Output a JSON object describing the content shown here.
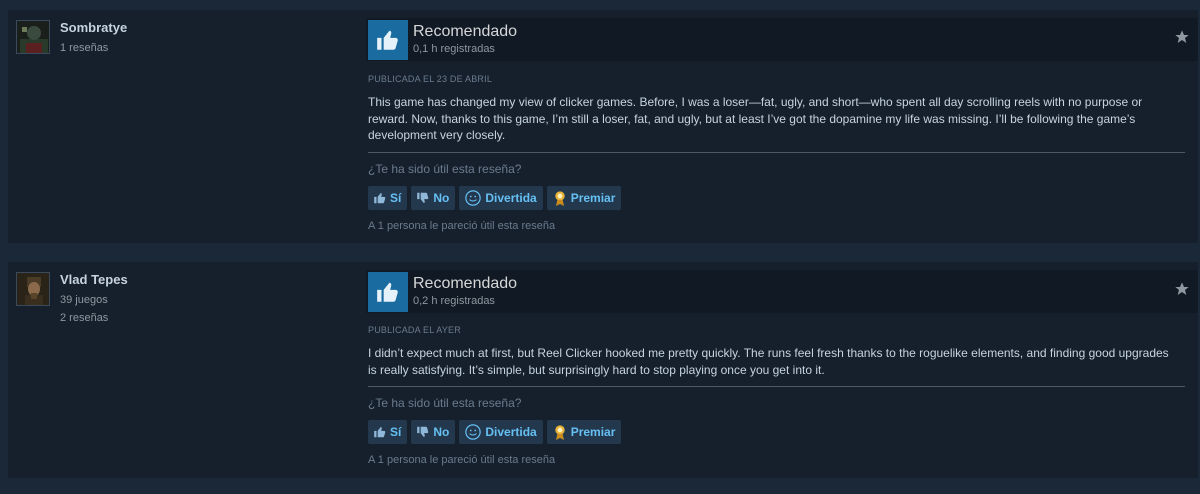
{
  "reviews": [
    {
      "author": "Sombratye",
      "author_lines": [
        "1 reseñas"
      ],
      "verdict": "Recomendado",
      "hours": "0,1 h registradas",
      "posted": "PUBLICADA EL 23 DE ABRIL",
      "text": "This game has changed my view of clicker games. Before, I was a loser—fat, ugly, and short—who spent all day scrolling reels with no purpose or reward. Now, thanks to this game, I’m still a loser, fat, and ugly, but at least I’ve got the dopamine my life was missing. I’ll be following the game’s development very closely.",
      "helpful_question": "¿Te ha sido útil esta reseña?",
      "buttons": {
        "yes": "Sí",
        "no": "No",
        "funny": "Divertida",
        "award": "Premiar"
      },
      "found_helpful": "A 1 persona le pareció útil esta reseña"
    },
    {
      "author": "Vlad Tepes",
      "author_lines": [
        "39 juegos",
        "2 reseñas"
      ],
      "verdict": "Recomendado",
      "hours": "0,2 h registradas",
      "posted": "PUBLICADA EL AYER",
      "text": "I didn’t expect much at first, but Reel Clicker hooked me pretty quickly. The runs feel fresh thanks to the roguelike elements, and finding good upgrades is really satisfying. It’s simple, but surprisingly hard to stop playing once you get into it.",
      "helpful_question": "¿Te ha sido útil esta reseña?",
      "buttons": {
        "yes": "Sí",
        "no": "No",
        "funny": "Divertida",
        "award": "Premiar"
      },
      "found_helpful": "A 1 persona le pareció útil esta reseña"
    }
  ],
  "icons": {
    "thumbs_up": "thumbs-up-icon",
    "thumbs_down": "thumbs-down-icon",
    "smiley": "smiley-icon",
    "award": "award-icon",
    "star": "star-icon"
  },
  "colors": {
    "background": "#1b2838",
    "card": "#16202d",
    "accent": "#66c0f4",
    "thumb_box": "#1a6ba0"
  }
}
